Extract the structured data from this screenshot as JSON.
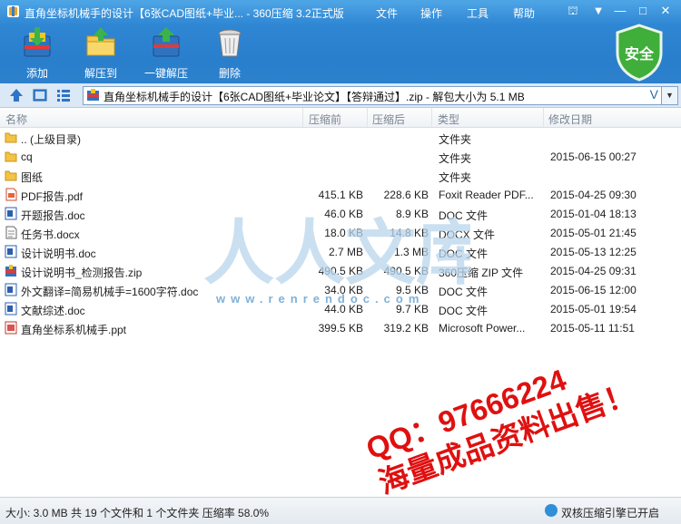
{
  "window": {
    "title": "直角坐标机械手的设计【6张CAD图纸+毕业... - 360压缩 3.2正式版",
    "menu": [
      "文件",
      "操作",
      "工具",
      "帮助"
    ]
  },
  "toolbar": {
    "add": "添加",
    "extract_to": "解压到",
    "one_click_extract": "一键解压",
    "delete": "删除",
    "security": "安全"
  },
  "address": {
    "path": "直角坐标机械手的设计【6张CAD图纸+毕业论文】【答辩通过】.zip - 解包大小为 5.1 MB",
    "v_button": "V"
  },
  "columns": {
    "name": "名称",
    "size": "压缩前",
    "packed": "压缩后",
    "type": "类型",
    "modified": "修改日期"
  },
  "files": [
    {
      "name": ".. (上级目录)",
      "size": "",
      "packed": "",
      "type": "文件夹",
      "date": "",
      "icon": "folder-icon"
    },
    {
      "name": "cq",
      "size": "",
      "packed": "",
      "type": "文件夹",
      "date": "2015-06-15 00:27",
      "icon": "folder-icon"
    },
    {
      "name": "图纸",
      "size": "",
      "packed": "",
      "type": "文件夹",
      "date": "",
      "icon": "folder-icon"
    },
    {
      "name": "PDF报告.pdf",
      "size": "415.1 KB",
      "packed": "228.6 KB",
      "type": "Foxit Reader PDF...",
      "date": "2015-04-25 09:30",
      "icon": "pdf-icon"
    },
    {
      "name": "开题报告.doc",
      "size": "46.0 KB",
      "packed": "8.9 KB",
      "type": "DOC 文件",
      "date": "2015-01-04 18:13",
      "icon": "doc-icon"
    },
    {
      "name": "任务书.docx",
      "size": "18.0 KB",
      "packed": "14.8 KB",
      "type": "DOCX 文件",
      "date": "2015-05-01 21:45",
      "icon": "docx-icon"
    },
    {
      "name": "设计说明书.doc",
      "size": "2.7 MB",
      "packed": "1.3 MB",
      "type": "DOC 文件",
      "date": "2015-05-13 12:25",
      "icon": "doc-icon"
    },
    {
      "name": "设计说明书_检测报告.zip",
      "size": "490.5 KB",
      "packed": "490.5 KB",
      "type": "360压缩 ZIP 文件",
      "date": "2015-04-25 09:31",
      "icon": "zip-icon"
    },
    {
      "name": "外文翻译=简易机械手=1600字符.doc",
      "size": "34.0 KB",
      "packed": "9.5 KB",
      "type": "DOC 文件",
      "date": "2015-06-15 12:00",
      "icon": "doc-icon"
    },
    {
      "name": "文献综述.doc",
      "size": "44.0 KB",
      "packed": "9.7 KB",
      "type": "DOC 文件",
      "date": "2015-05-01 19:54",
      "icon": "doc-icon"
    },
    {
      "name": "直角坐标系机械手.ppt",
      "size": "399.5 KB",
      "packed": "319.2 KB",
      "type": "Microsoft Power...",
      "date": "2015-05-11 11:51",
      "icon": "ppt-icon"
    }
  ],
  "watermark": {
    "logo_text": "人人文库",
    "url": "www.renrendoc.com",
    "qq_line": "QQ：97666224",
    "sale_line": "海量成品资料出售！"
  },
  "status": {
    "summary": "大小: 3.0 MB 共 19 个文件和 1 个文件夹 压缩率 58.0%",
    "core": "双核压缩引擎已开启"
  },
  "colors": {
    "titlebar": "#2f86d3",
    "shield": "#3fae3a",
    "watermark_red": "#e01010",
    "watermark_blue": "#7fb1d8"
  }
}
